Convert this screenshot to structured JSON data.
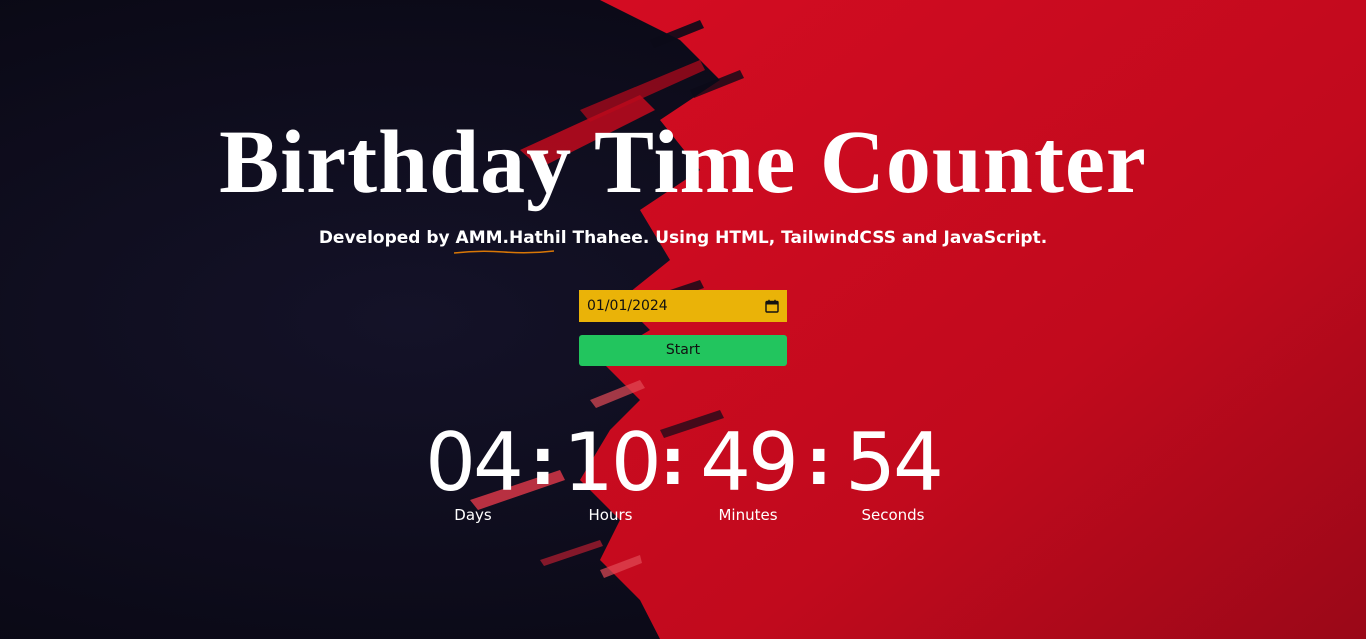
{
  "header": {
    "title": "Birthday Time Counter",
    "subtitle_prefix": "Developed by ",
    "author": "AMM.Hathil Thahee",
    "subtitle_suffix": ". Using HTML, TailwindCSS and JavaScript."
  },
  "form": {
    "date_value": "01/01/2024",
    "start_label": "Start"
  },
  "countdown": {
    "days": "04",
    "hours": "10",
    "minutes": "49",
    "seconds": "54",
    "days_label": "Days",
    "hours_label": "Hours",
    "minutes_label": "Minutes",
    "seconds_label": "Seconds",
    "separator": ":"
  },
  "colors": {
    "background_dark": "#0b0a18",
    "background_red": "#c8081c",
    "date_field": "#eab308",
    "start_button": "#22c55e",
    "underline": "#d97706"
  },
  "icons": {
    "date_picker": "calendar-icon"
  }
}
